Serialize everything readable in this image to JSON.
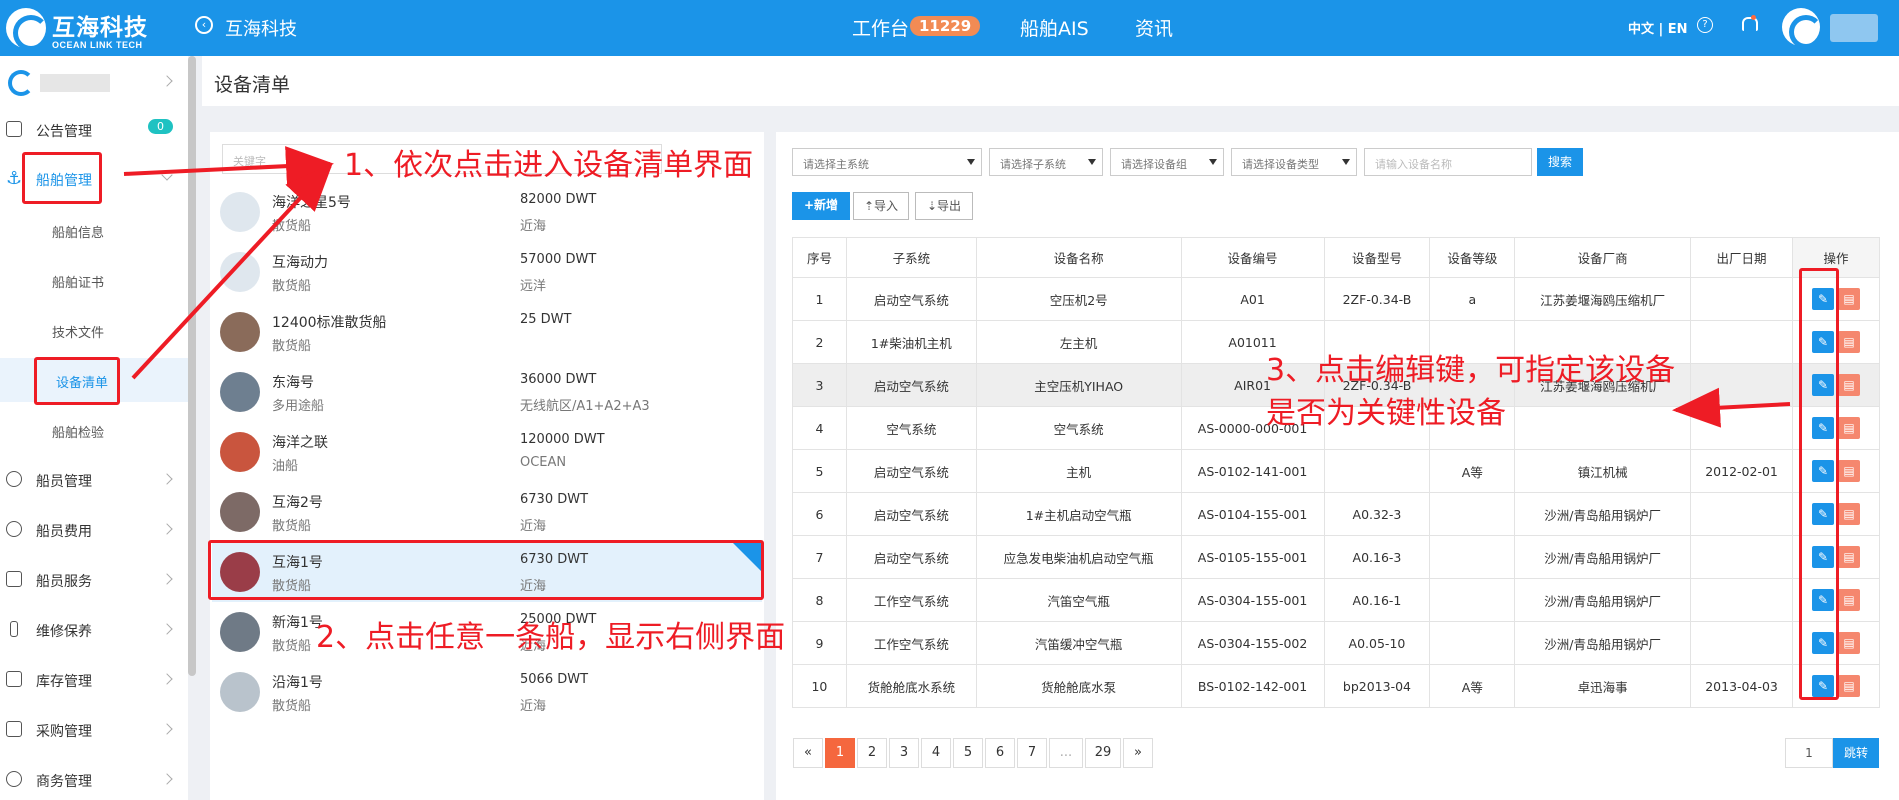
{
  "header": {
    "logo_cn": "互海科技",
    "logo_en": "OCEAN LINK TECH",
    "company": "互海科技",
    "nav": {
      "workbench": "工作台",
      "workbench_count": "11229",
      "ais": "船舶AIS",
      "news": "资讯"
    },
    "lang": "中文 | EN",
    "help_glyph": "?"
  },
  "sidebar": {
    "items": [
      {
        "label": "公告管理",
        "badge": "0"
      },
      {
        "label": "船舶管理"
      },
      {
        "label": "船舶信息"
      },
      {
        "label": "船舶证书"
      },
      {
        "label": "技术文件"
      },
      {
        "label": "设备清单"
      },
      {
        "label": "船舶检验"
      },
      {
        "label": "船员管理"
      },
      {
        "label": "船员费用"
      },
      {
        "label": "船员服务"
      },
      {
        "label": "维修保养"
      },
      {
        "label": "库存管理"
      },
      {
        "label": "采购管理"
      },
      {
        "label": "商务管理"
      }
    ]
  },
  "page": {
    "title": "设备清单"
  },
  "ship_list": {
    "search_placeholder": "关键字",
    "ships": [
      {
        "name": "海洋之星5号",
        "type": "散货船",
        "dwt": "82000 DWT",
        "area": "近海"
      },
      {
        "name": "互海动力",
        "type": "散货船",
        "dwt": "57000 DWT",
        "area": "远洋"
      },
      {
        "name": "12400标准散货船",
        "type": "散货船",
        "dwt": "25 DWT",
        "area": ""
      },
      {
        "name": "东海号",
        "type": "多用途船",
        "dwt": "36000 DWT",
        "area": "无线航区/A1+A2+A3"
      },
      {
        "name": "海洋之联",
        "type": "油船",
        "dwt": "120000 DWT",
        "area": "OCEAN"
      },
      {
        "name": "互海2号",
        "type": "散货船",
        "dwt": "6730 DWT",
        "area": "近海"
      },
      {
        "name": "互海1号",
        "type": "散货船",
        "dwt": "6730 DWT",
        "area": "近海"
      },
      {
        "name": "新海1号",
        "type": "散货船",
        "dwt": "25000 DWT",
        "area": "近海"
      },
      {
        "name": "沿海1号",
        "type": "散货船",
        "dwt": "5066 DWT",
        "area": "近海"
      }
    ]
  },
  "filters": {
    "main_system": "请选择主系统",
    "sub_system": "请选择子系统",
    "device_group": "请选择设备组",
    "device_type": "请选择设备类型",
    "device_name_placeholder": "请输入设备名称",
    "search_label": "搜索"
  },
  "toolbar": {
    "add_label": "+新增",
    "import_label": "⇡导入",
    "export_label": "⇣导出"
  },
  "table": {
    "columns": [
      "序号",
      "子系统",
      "设备名称",
      "设备编号",
      "设备型号",
      "设备等级",
      "设备厂商",
      "出厂日期",
      "操作"
    ],
    "rows": [
      [
        "1",
        "启动空气系统",
        "空压机2号",
        "A01",
        "2ZF-0.34-B",
        "a",
        "江苏姜堰海鸥压缩机厂",
        ""
      ],
      [
        "2",
        "1#柴油机主机",
        "左主机",
        "A01011",
        "",
        "",
        "",
        ""
      ],
      [
        "3",
        "启动空气系统",
        "主空压机YIHAO",
        "AIR01",
        "2ZF-0.34-B",
        "",
        "江苏姜堰海鸥压缩机厂",
        ""
      ],
      [
        "4",
        "空气系统",
        "空气系统",
        "AS-0000-000-001",
        "",
        "",
        "",
        ""
      ],
      [
        "5",
        "启动空气系统",
        "主机",
        "AS-0102-141-001",
        "",
        "A等",
        "镇江机械",
        "2012-02-01"
      ],
      [
        "6",
        "启动空气系统",
        "1#主机启动空气瓶",
        "AS-0104-155-001",
        "A0.32-3",
        "",
        "沙洲/青岛船用锅炉厂",
        ""
      ],
      [
        "7",
        "启动空气系统",
        "应急发电柴油机启动空气瓶",
        "AS-0105-155-001",
        "A0.16-3",
        "",
        "沙洲/青岛船用锅炉厂",
        ""
      ],
      [
        "8",
        "工作空气系统",
        "汽笛空气瓶",
        "AS-0304-155-001",
        "A0.16-1",
        "",
        "沙洲/青岛船用锅炉厂",
        ""
      ],
      [
        "9",
        "工作空气系统",
        "汽笛缓冲空气瓶",
        "AS-0304-155-002",
        "A0.05-10",
        "",
        "沙洲/青岛船用锅炉厂",
        ""
      ],
      [
        "10",
        "货舱舱底水系统",
        "货舱舱底水泵",
        "BS-0102-142-001",
        "bp2013-04",
        "A等",
        "卓迅海事",
        "2013-04-03"
      ]
    ],
    "edit_glyph": "✎",
    "delete_glyph": "▤"
  },
  "pagination": {
    "pages": [
      "«",
      "1",
      "2",
      "3",
      "4",
      "5",
      "6",
      "7",
      "...",
      "29",
      "»"
    ],
    "current": "1",
    "jump_value": "1",
    "jump_label": "跳转"
  },
  "annotations": {
    "step1": "1、依次点击进入设备清单界面",
    "step2": "2、点击任意一条船，显示右侧界面",
    "step3_line1": "3、点击编辑键，可指定该设备",
    "step3_line2": "是否为关键性设备",
    "color": "#ee1c25"
  },
  "colors": {
    "brand": "#1b94e8",
    "accent": "#f5673e"
  }
}
